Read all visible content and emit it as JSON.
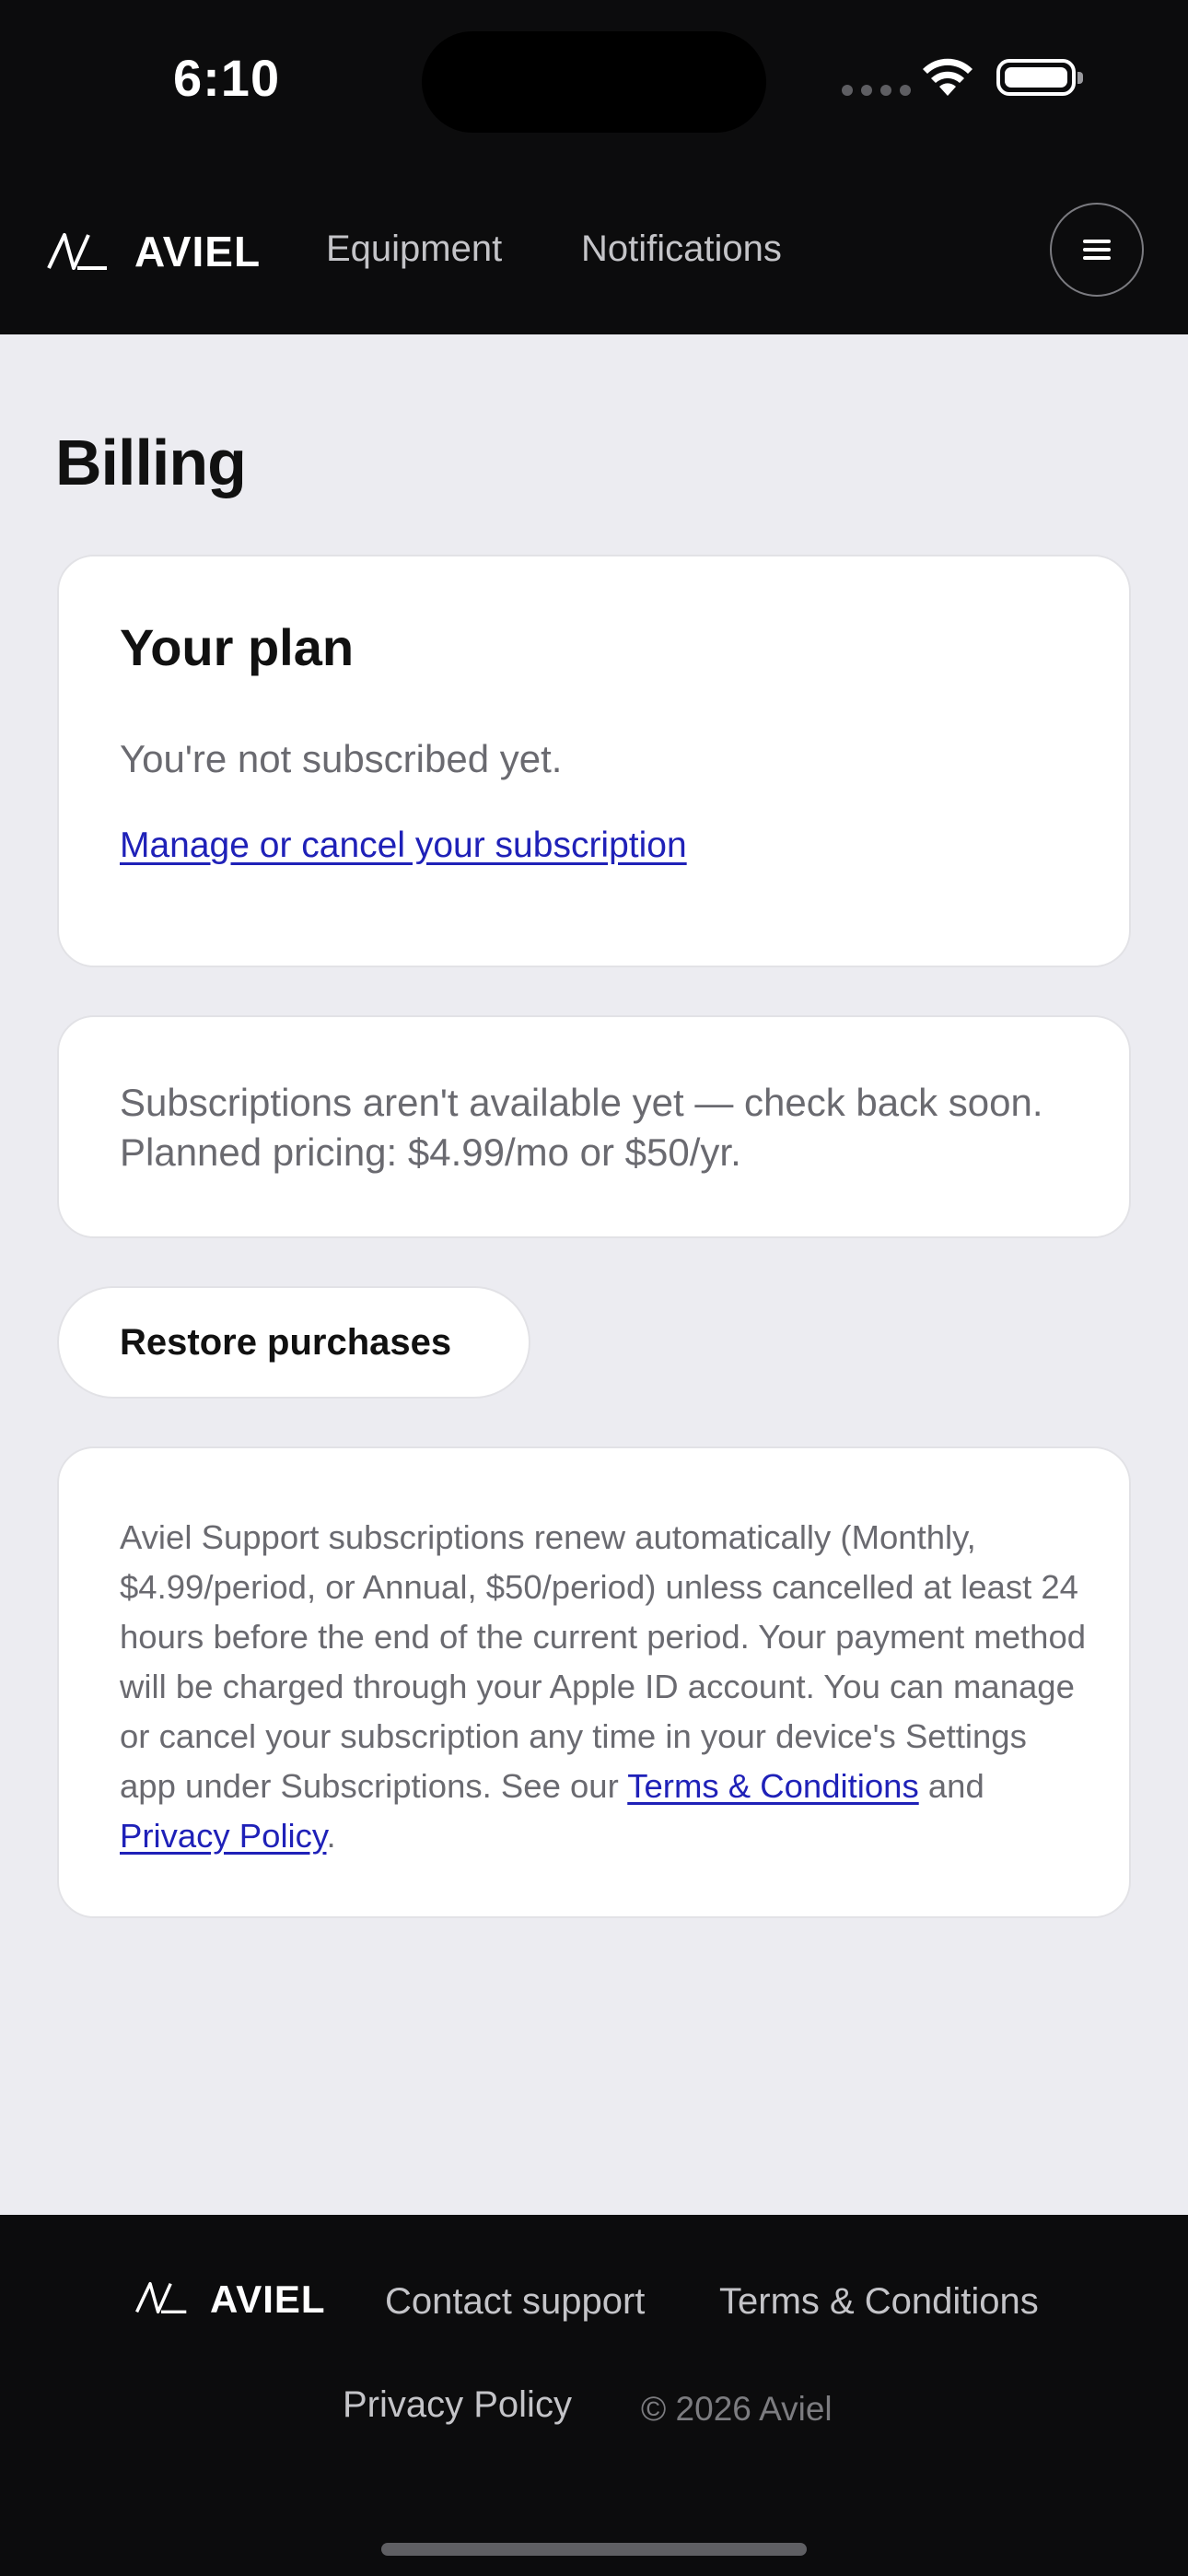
{
  "status_bar": {
    "time": "6:10",
    "icons": [
      "cellular-signal-icon",
      "wifi-icon",
      "battery-icon"
    ]
  },
  "nav": {
    "brand": "AVIEL",
    "links": [
      "Equipment",
      "Notifications"
    ],
    "menu_icon": "hamburger-menu-icon"
  },
  "page": {
    "title": "Billing"
  },
  "plan_card": {
    "heading": "Your plan",
    "status": "You're not subscribed yet.",
    "manage_link": "Manage or cancel your subscription"
  },
  "notice_card": {
    "text": "Subscriptions aren't available yet — check back soon. Planned pricing: $4.99/mo or $50/yr."
  },
  "restore_button": "Restore purchases",
  "legal_card": {
    "text": "Aviel Support subscriptions renew automatically (Monthly, $4.99/period, or Annual, $50/period) unless cancelled at least 24 hours before the end of the current period. Your payment method will be charged through your Apple ID account. You can manage or cancel your subscription any time in your device's Settings app under Subscriptions. See our",
    "terms_link": "Terms & Conditions",
    "joiner": "and",
    "privacy_link": "Privacy Policy",
    "end": "."
  },
  "footer": {
    "brand": "AVIEL",
    "contact": "Contact support",
    "terms": "Terms & Conditions",
    "privacy": "Privacy Policy",
    "copyright": "© 2026 Aviel"
  },
  "colors": {
    "dark_bg": "#0c0c0d",
    "page_bg": "#ececf1",
    "link": "#1f21b8",
    "muted_text": "#6a6a70"
  }
}
